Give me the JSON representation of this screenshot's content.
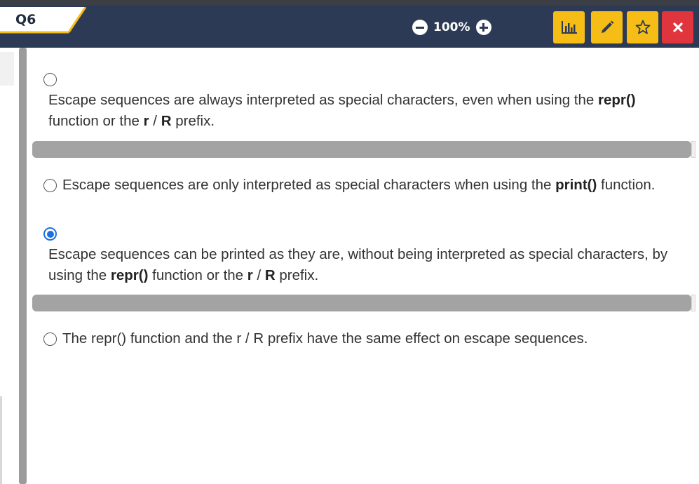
{
  "header": {
    "question_label": "Q6",
    "zoom_level": "100%",
    "zoom_out_icon": "minus-circle-icon",
    "zoom_in_icon": "plus-circle-icon",
    "toolbar_icons": [
      "bar-chart-icon",
      "pencil-icon",
      "star-icon",
      "close-icon"
    ]
  },
  "options": [
    {
      "selected": false,
      "parts": [
        {
          "t": "Escape sequences are always interpreted as special characters, even when using the ",
          "b": false
        },
        {
          "t": "repr()",
          "b": true
        },
        {
          "t": " function or the ",
          "b": false
        },
        {
          "t": "r",
          "b": true
        },
        {
          "t": " / ",
          "b": false
        },
        {
          "t": "R",
          "b": true
        },
        {
          "t": " prefix.",
          "b": false
        }
      ]
    },
    {
      "selected": false,
      "parts": [
        {
          "t": "Escape sequences are only interpreted as special characters when using the ",
          "b": false
        },
        {
          "t": "print()",
          "b": true
        },
        {
          "t": " function.",
          "b": false
        }
      ]
    },
    {
      "selected": true,
      "parts": [
        {
          "t": "Escape sequences can be printed as they are, without being interpreted as special characters, by using the ",
          "b": false
        },
        {
          "t": "repr()",
          "b": true
        },
        {
          "t": " function or the ",
          "b": false
        },
        {
          "t": "r",
          "b": true
        },
        {
          "t": " / ",
          "b": false
        },
        {
          "t": "R",
          "b": true
        },
        {
          "t": " prefix.",
          "b": false
        }
      ]
    },
    {
      "selected": false,
      "parts": [
        {
          "t": "The repr() function and the r / R prefix have the same effect on escape sequences.",
          "b": false
        }
      ]
    }
  ],
  "colors": {
    "header_bg": "#2c3a55",
    "accent_yellow": "#f6bd16",
    "close_red": "#e0353c",
    "radio_selected": "#1b6fe0",
    "separator": "#a3a3a3"
  }
}
